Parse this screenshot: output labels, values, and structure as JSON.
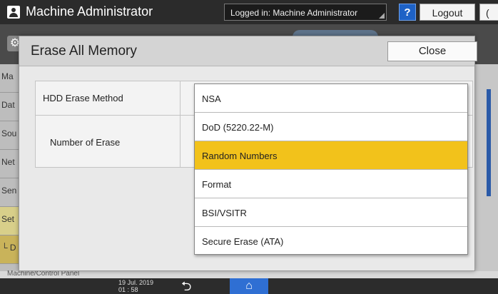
{
  "topbar": {
    "title": "Machine Administrator",
    "login_status": "Logged in: Machine Administrator",
    "help_label": "?",
    "logout_label": "Logout",
    "moon_label": "("
  },
  "dialog": {
    "title": "Erase All Memory",
    "close_label": "Close",
    "rows": {
      "method_label": "HDD Erase Method",
      "count_label": "Number of Erase"
    }
  },
  "dropdown": {
    "options": [
      "NSA",
      "DoD (5220.22-M)",
      "Random Numbers",
      "Format",
      "BSI/VSITR",
      "Secure Erase (ATA)"
    ],
    "selected": "Random Numbers"
  },
  "background": {
    "sidebar": [
      "Ma",
      "Dat",
      "Sou",
      "Net",
      "Sen",
      "Set",
      "└ D"
    ],
    "bottom_text": "Machine/Control Panel"
  },
  "bottombar": {
    "date": "19 Jul. 2019",
    "time": "01 : 58"
  },
  "colors": {
    "accent_yellow": "#f2c21b",
    "accent_blue": "#2f6fd3"
  }
}
